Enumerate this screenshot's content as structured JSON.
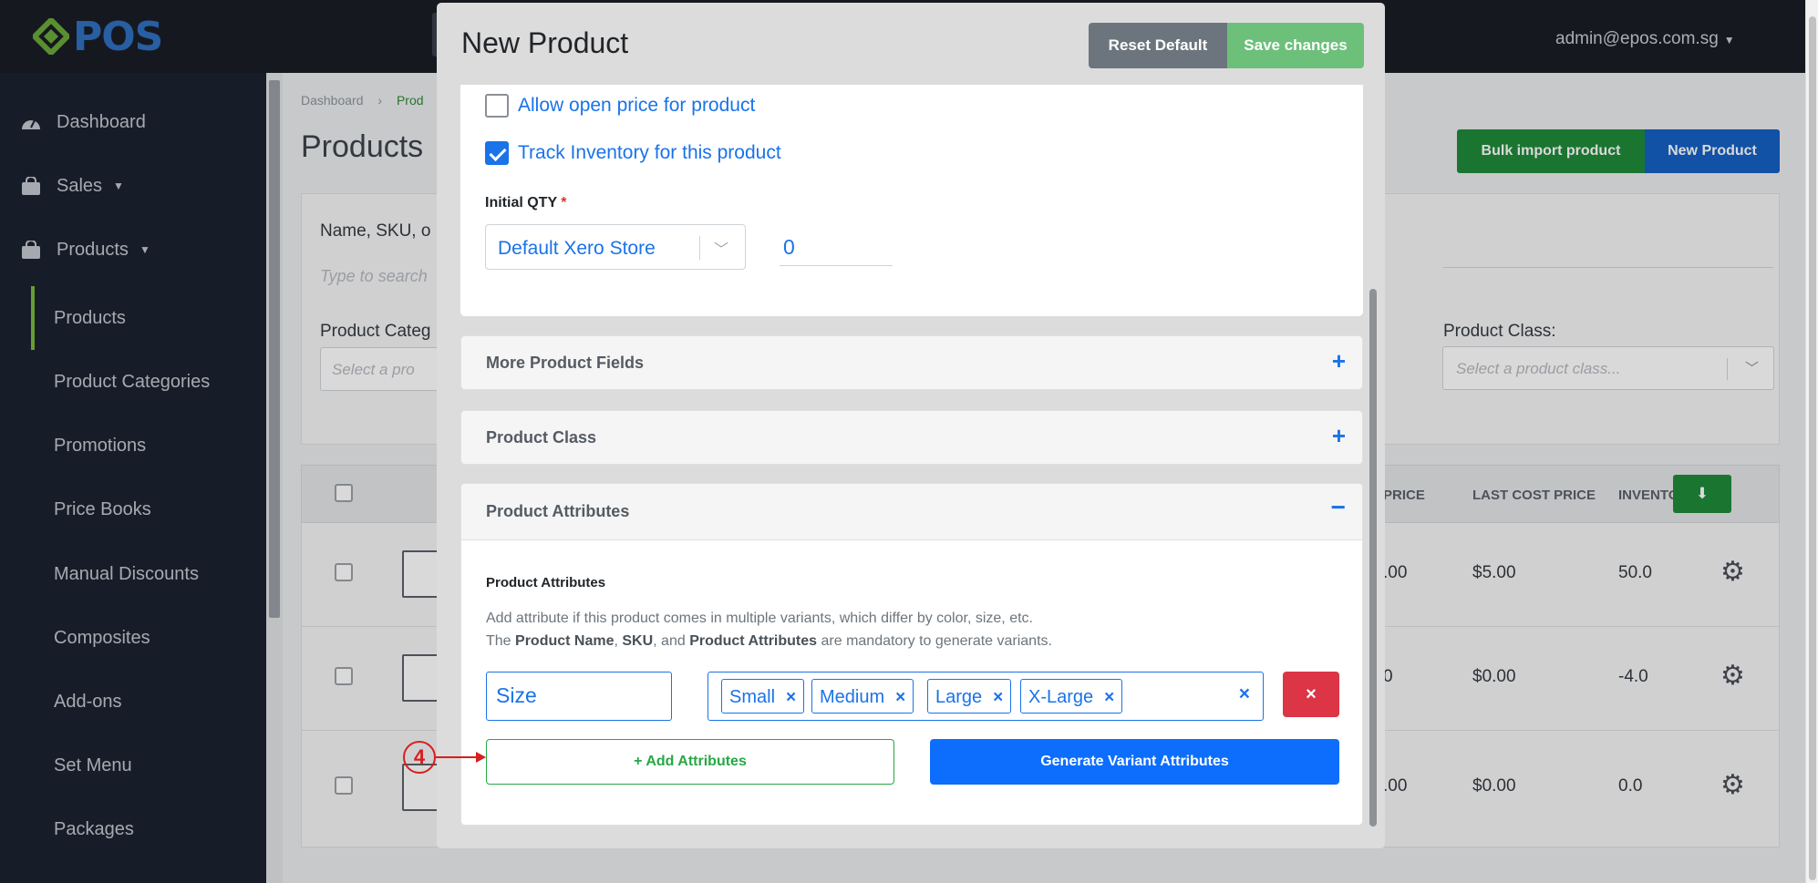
{
  "header": {
    "logo_text": "POS",
    "user_email": "admin@epos.com.sg"
  },
  "sidebar": {
    "items": [
      {
        "label": "Dashboard"
      },
      {
        "label": "Sales"
      },
      {
        "label": "Products"
      }
    ],
    "sub_items": [
      {
        "label": "Products"
      },
      {
        "label": "Product Categories"
      },
      {
        "label": "Promotions"
      },
      {
        "label": "Price Books"
      },
      {
        "label": "Manual Discounts"
      },
      {
        "label": "Composites"
      },
      {
        "label": "Add-ons"
      },
      {
        "label": "Set Menu"
      },
      {
        "label": "Packages"
      }
    ]
  },
  "page": {
    "breadcrumb_root": "Dashboard",
    "breadcrumb_sep": "›",
    "breadcrumb_current": "Prod",
    "title": "Products",
    "bulk_import_label": "Bulk import product",
    "new_product_label": "New Product",
    "filter_search_label": "Name, SKU, o",
    "filter_search_placeholder": "Type to search",
    "filter_category_label": "Product Categ",
    "filter_category_placeholder": "Select a pro",
    "filter_class_label": "Product Class:",
    "filter_class_placeholder": "Select a product class...",
    "table_headers": {
      "price": "PRICE",
      "last_cost": "LAST COST PRICE",
      "inventory": "INVENTORY"
    },
    "rows": [
      {
        "price": ".00",
        "last_cost": "$5.00",
        "inventory": "50.0"
      },
      {
        "price": "0",
        "last_cost": "$0.00",
        "inventory": "-4.0"
      },
      {
        "price": ".00",
        "last_cost": "$0.00",
        "inventory": "0.0"
      }
    ]
  },
  "modal": {
    "title": "New Product",
    "reset_label": "Reset Default",
    "save_label": "Save changes",
    "allow_open_price_label": "Allow open price for product",
    "allow_open_price_checked": false,
    "track_inventory_label": "Track Inventory for this product",
    "track_inventory_checked": true,
    "initial_qty_label": "Initial QTY",
    "required_mark": "*",
    "store_value": "Default Xero Store",
    "qty_value": "0",
    "sections": [
      {
        "label": "More Product Fields",
        "toggle": "+"
      },
      {
        "label": "Product Class",
        "toggle": "+"
      }
    ],
    "attributes_section": {
      "label": "Product Attributes",
      "toggle": "−",
      "subtitle": "Product Attributes",
      "desc_line1": "Add attribute if this product comes in multiple variants, which differ by color, size, etc.",
      "desc_line2_parts": [
        "The ",
        "Product Name",
        ", ",
        "SKU",
        ", and ",
        "Product Attributes",
        " are mandatory to generate variants."
      ],
      "attribute_name": "Size",
      "values": [
        "Small",
        "Medium",
        "Large",
        "X-Large"
      ],
      "remove_symbol": "×",
      "add_label": "+ Add Attributes",
      "generate_label": "Generate Variant Attributes"
    }
  },
  "annotation": {
    "step_number": "4",
    "color": "#d81e1e"
  }
}
